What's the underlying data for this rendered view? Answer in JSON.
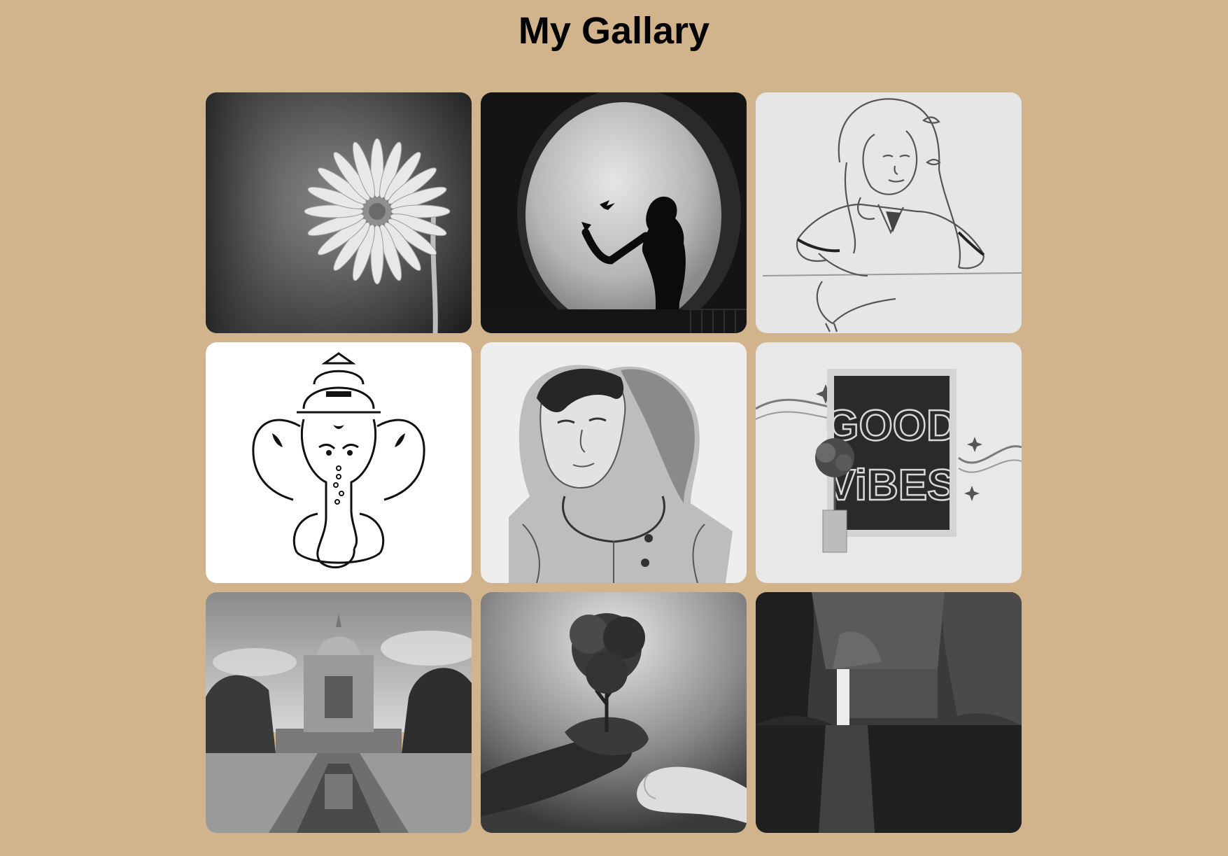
{
  "header": {
    "title": "My Gallary"
  },
  "gallery": {
    "items": [
      {
        "icon": "daisy-flower-icon"
      },
      {
        "icon": "moon-silhouette-icon"
      },
      {
        "icon": "girl-sketch-icon"
      },
      {
        "icon": "ganesha-drawing-icon"
      },
      {
        "icon": "hooded-boy-sketch-icon"
      },
      {
        "icon": "good-vibes-board-icon"
      },
      {
        "icon": "monument-reflection-icon"
      },
      {
        "icon": "tree-on-hand-icon"
      },
      {
        "icon": "waterfall-gorge-icon"
      }
    ],
    "sign_text": [
      "GOOD",
      "ViBES"
    ]
  },
  "colors": {
    "background": "#d2b48c",
    "title": "#000000"
  }
}
